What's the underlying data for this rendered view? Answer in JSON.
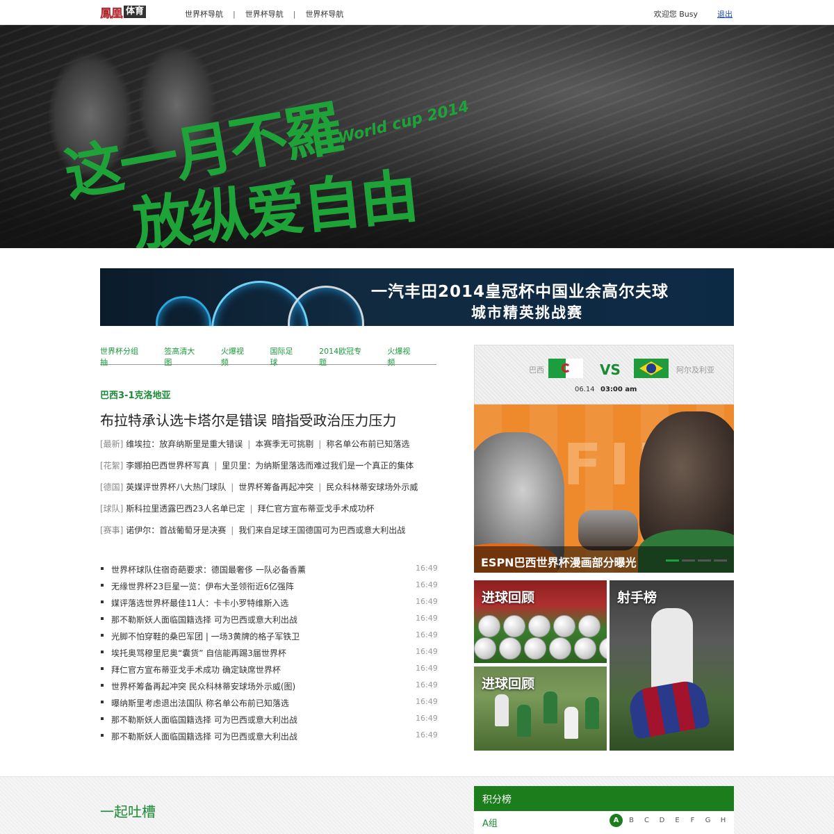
{
  "topbar": {
    "logo_brand": "鳳凰",
    "logo_sub": "体育",
    "nav": [
      "世界杯导航",
      "世界杯导航",
      "世界杯导航"
    ],
    "nav_sep": "|",
    "welcome": "欢迎您 Busy",
    "logout": "退出"
  },
  "hero": {
    "slogan_line1": "这一月不羅",
    "slogan_line2": "放纵爱自由",
    "worldcup": "World cup 2014",
    "accent_color": "#1ea339"
  },
  "ad": {
    "line1": "一汽丰田2014皇冠杯中国业余高尔夫球",
    "line2": "城市精英挑战赛"
  },
  "subnav": [
    "世界杯分组抽",
    "签高清大图",
    "火爆视频",
    "国际足球",
    "2014欧冠专题",
    "火爆视频"
  ],
  "headline": {
    "tag": "巴西3-1克洛地亚",
    "title": "布拉特承认选卡塔尔是错误 暗指受政治压力压力"
  },
  "category_rows": [
    {
      "cat": "[最新]",
      "items": [
        "维埃拉：放弃纳斯里是重大错误",
        "本赛季无可挑剔",
        "称名单公布前已知落选"
      ]
    },
    {
      "cat": "[花絮]",
      "items": [
        "李娜拍巴西世界杯写真",
        "里贝里：为纳斯里落选而难过我们是一个真正的集体"
      ]
    },
    {
      "cat": "[德国]",
      "items": [
        "英媒评世界杯八大热门球队",
        "世界杯筹备再起冲突",
        "民众科林蒂安球场外示威"
      ]
    },
    {
      "cat": "[球队]",
      "items": [
        "斯科拉里透露巴西23人名单已定",
        "拜仁官方宣布蒂亚戈手术成功杯"
      ]
    },
    {
      "cat": "[赛事]",
      "items": [
        "诺伊尔：首战葡萄牙是决赛",
        "我们来自足球王国德国可为巴西或意大利出战"
      ]
    }
  ],
  "news_list": [
    {
      "title": "世界杯球队住宿奇葩要求：德国最奢侈  一队必备香薰",
      "time": "16:49"
    },
    {
      "title": "无缘世界杯23巨星一览：伊布大圣领衔近6亿强阵",
      "time": "16:49"
    },
    {
      "title": "媒评落选世界杯最佳11人：卡卡小罗特维斯入选",
      "time": "16:49"
    },
    {
      "title": "那不勒斯妖人面临国籍选择  可为巴西或意大利出战",
      "time": "16:49"
    },
    {
      "title": "光脚不怕穿鞋的桑巴军团  |  一场3黄牌的格子军铁卫",
      "time": "16:49"
    },
    {
      "title": "埃托奥骂穆里尼奥“囊货”  自信能再踢3届世界杯",
      "time": "16:49"
    },
    {
      "title": "拜仁官方宣布蒂亚戈手术成功  确定缺席世界杯",
      "time": "16:49"
    },
    {
      "title": "世界杯筹备再起冲突  民众科林蒂安球场外示威(图)",
      "time": "16:49"
    },
    {
      "title": "曝纳斯里考虑退出法国队  称名单公布前已知落选",
      "time": "16:49"
    },
    {
      "title": "那不勒斯妖人面临国籍选择  可为巴西或意大利出战",
      "time": "16:49"
    },
    {
      "title": "那不勒斯妖人面临国籍选择  可为巴西或意大利出战",
      "time": "16:49"
    }
  ],
  "match": {
    "team_left": "巴西",
    "vs": "VS",
    "team_right": "阿尔及利亚",
    "date": "06.14",
    "time": "03:00 am"
  },
  "feature": {
    "caption": "ESPN巴西世界杯漫画部分曝光",
    "watermark": "FIF",
    "slides": 4,
    "active_slide": 1
  },
  "tiles": {
    "tile1": "进球回顾",
    "tile2": "进球回顾",
    "tile3": "射手榜"
  },
  "bottom": {
    "tucao": "一起吐槽",
    "standings_title": "积分榜",
    "group_label": "A组",
    "groups": [
      "A",
      "B",
      "C",
      "D",
      "E",
      "F",
      "G",
      "H"
    ],
    "active_group": "A"
  }
}
